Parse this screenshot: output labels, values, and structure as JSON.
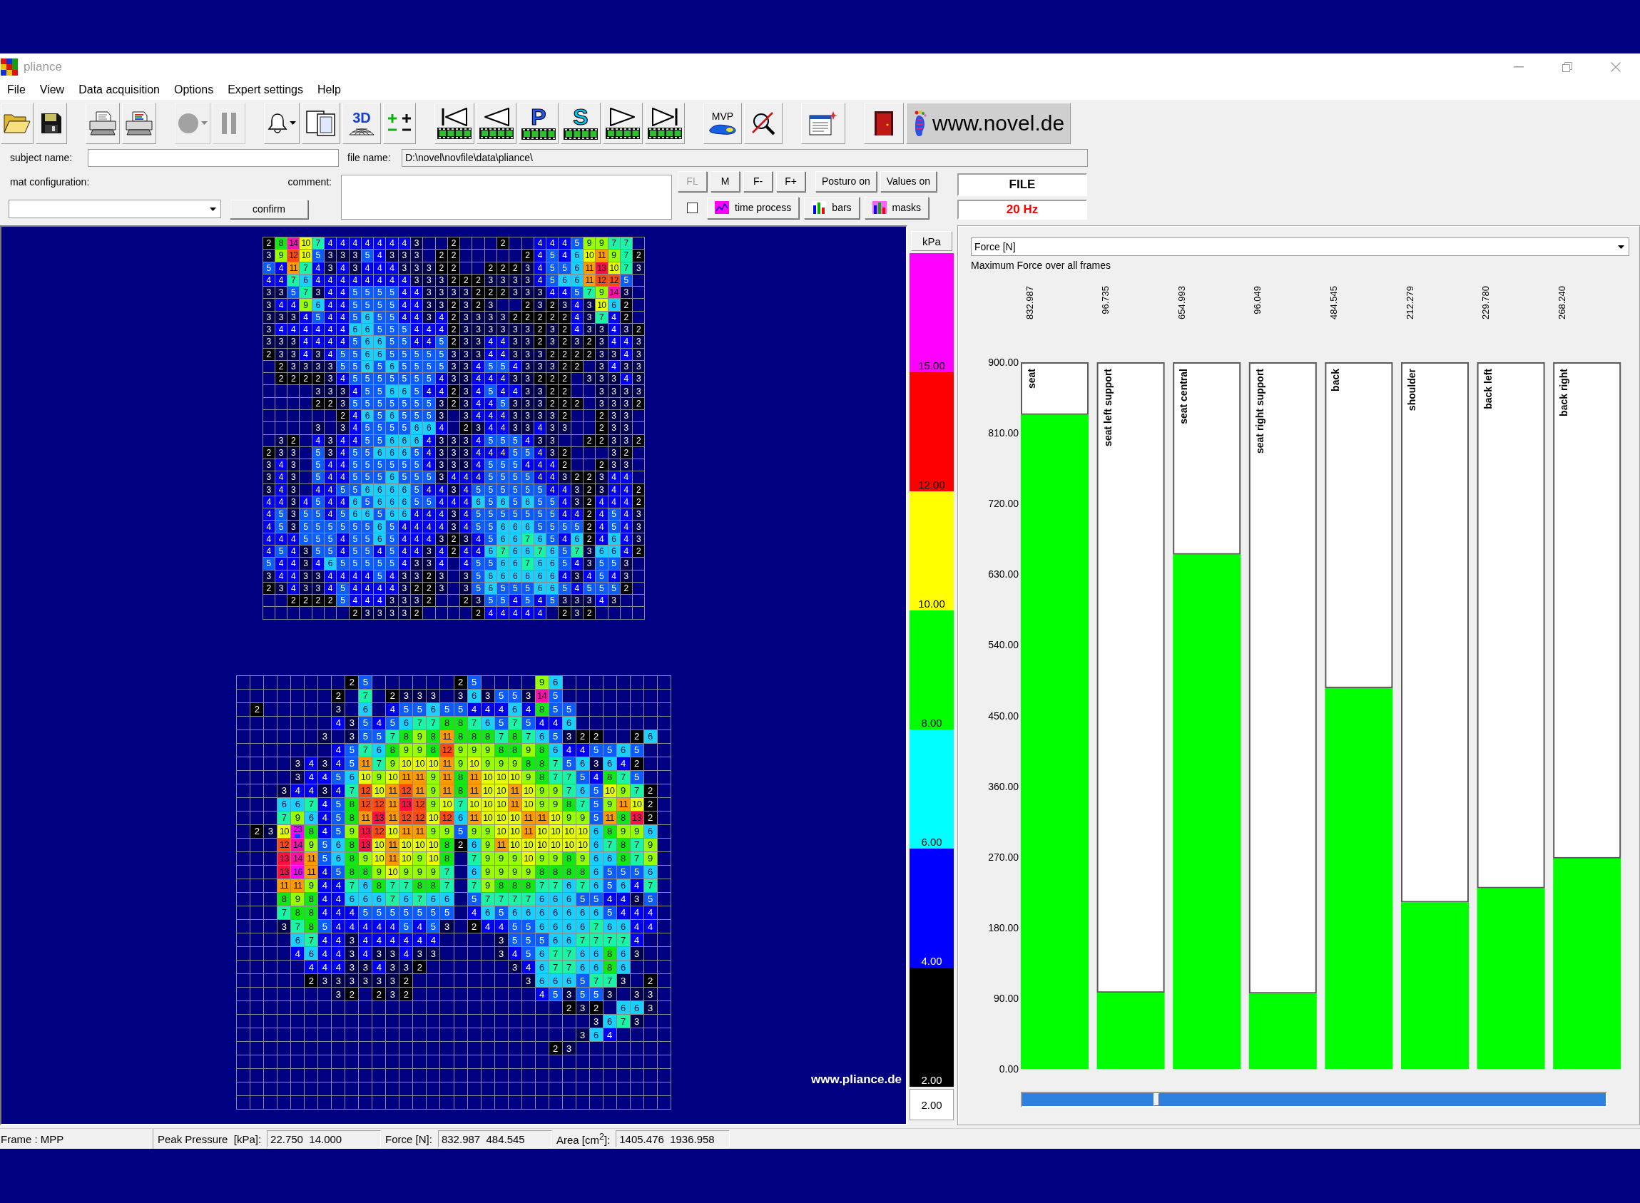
{
  "window": {
    "title": "pliance"
  },
  "menu": [
    "File",
    "View",
    "Data acquisition",
    "Options",
    "Expert settings",
    "Help"
  ],
  "toolbar": [
    [
      {
        "kind": "open",
        "disabled": false,
        "dropdown": false
      },
      {
        "kind": "save",
        "disabled": false,
        "dropdown": false
      }
    ],
    [
      {
        "kind": "print",
        "disabled": false,
        "dropdown": false
      },
      {
        "kind": "colorprint",
        "disabled": false,
        "dropdown": false
      }
    ],
    [
      {
        "kind": "record",
        "disabled": true,
        "dropdown": true
      },
      {
        "kind": "pause",
        "disabled": true,
        "dropdown": false
      }
    ],
    [
      {
        "kind": "bell",
        "disabled": false,
        "dropdown": true
      },
      {
        "kind": "pages",
        "disabled": false,
        "dropdown": false
      },
      {
        "kind": "mesh",
        "label": "3D",
        "disabled": false,
        "dropdown": false
      },
      {
        "kind": "plusminus",
        "disabled": false,
        "dropdown": false
      }
    ],
    [
      {
        "kind": "first",
        "disabled": false,
        "dropdown": false
      },
      {
        "kind": "previous",
        "disabled": false,
        "dropdown": false
      },
      {
        "kind": "letter",
        "label": "P",
        "color": "#1c5cff",
        "disabled": false,
        "dropdown": false
      },
      {
        "kind": "letter",
        "label": "S",
        "color": "#00c8f0",
        "disabled": false,
        "dropdown": false
      },
      {
        "kind": "next",
        "disabled": false,
        "dropdown": false
      },
      {
        "kind": "last",
        "disabled": false,
        "dropdown": false
      }
    ],
    [
      {
        "kind": "mvp",
        "label": "MVP",
        "disabled": false,
        "dropdown": false
      },
      {
        "kind": "nosearch",
        "disabled": false,
        "dropdown": false
      }
    ],
    [
      {
        "kind": "notepad",
        "disabled": false,
        "dropdown": false
      }
    ],
    [
      {
        "kind": "exit",
        "disabled": false,
        "dropdown": false
      },
      {
        "kind": "link",
        "label": "www.novel.de",
        "disabled": false,
        "dropdown": false
      }
    ]
  ],
  "form": {
    "subject_name": {
      "label": "subject name:"
    },
    "file_name": {
      "label": "file name:",
      "value": "D:\\novel\\novfile\\data\\pliance\\"
    },
    "mat_configuration": {
      "label": "mat configuration:"
    },
    "confirm_button": "confirm",
    "comment": {
      "label": "comment:"
    },
    "frame_buttons": [
      {
        "label": "FL",
        "disabled": true
      },
      {
        "label": "M",
        "disabled": false
      },
      {
        "label": "F-",
        "disabled": false
      },
      {
        "label": "F+",
        "disabled": false
      }
    ],
    "toggle_buttons": [
      {
        "label": "Posturo on"
      },
      {
        "label": "Values on"
      }
    ],
    "checkbox": {
      "checked": false
    },
    "display_buttons": [
      {
        "kind": "timeprocess",
        "label": "time process"
      },
      {
        "kind": "bars",
        "label": "bars"
      },
      {
        "kind": "masks",
        "label": "masks"
      }
    ],
    "source": "FILE",
    "rate": "20 Hz"
  },
  "pressure_maps": [
    {
      "rows": [
        [
          "2",
          "8",
          "14",
          "10",
          "7",
          "4",
          "4",
          "4",
          "4",
          "4",
          "4",
          "4",
          "3",
          null,
          null,
          "2",
          null,
          null,
          null,
          "2",
          null,
          null,
          "4",
          "4",
          "4",
          "5",
          "9",
          "9",
          "7",
          "7",
          null
        ],
        [
          "3",
          "9",
          "12",
          "10",
          "5",
          "3",
          "3",
          "3",
          "5",
          "4",
          "3",
          "3",
          "3",
          null,
          "2",
          "2",
          null,
          null,
          null,
          null,
          null,
          "2",
          "4",
          "5",
          "4",
          "6",
          "10",
          "11",
          "9",
          "7",
          "2"
        ],
        [
          "5",
          "4",
          "11",
          "7",
          "4",
          "3",
          "4",
          "3",
          "4",
          "4",
          "4",
          "3",
          "3",
          "3",
          "2",
          "2",
          null,
          null,
          "2",
          "2",
          "2",
          "3",
          "4",
          "5",
          "5",
          "6",
          "11",
          "13",
          "10",
          "7",
          "3"
        ],
        [
          "4",
          "4",
          "7",
          "6",
          "4",
          "4",
          "4",
          "4",
          "4",
          "4",
          "4",
          "4",
          "3",
          "3",
          "3",
          "2",
          "2",
          "2",
          "3",
          "3",
          "3",
          "3",
          "4",
          "5",
          "6",
          "6",
          "11",
          "12",
          "12",
          "5",
          null
        ],
        [
          "3",
          "3",
          "5",
          "7",
          "3",
          "4",
          "4",
          "5",
          "5",
          "5",
          "5",
          "4",
          "4",
          "3",
          "3",
          "3",
          "3",
          "2",
          "2",
          "2",
          "3",
          "3",
          "3",
          "4",
          "4",
          "5",
          "7",
          "9",
          "14",
          "3",
          null
        ],
        [
          "3",
          "4",
          "4",
          "9",
          "6",
          "4",
          "4",
          "5",
          "5",
          "5",
          "5",
          "4",
          "4",
          "3",
          "3",
          "2",
          "3",
          "2",
          "3",
          null,
          null,
          "2",
          "3",
          "2",
          "3",
          "4",
          "3",
          "10",
          "6",
          "2",
          null
        ],
        [
          "3",
          "3",
          "3",
          "4",
          "5",
          "4",
          "4",
          "5",
          "6",
          "5",
          "5",
          "4",
          "4",
          "3",
          "4",
          "2",
          "3",
          "3",
          "3",
          "3",
          "2",
          "2",
          "2",
          "2",
          "2",
          "4",
          "3",
          "7",
          "4",
          "2",
          null
        ],
        [
          "3",
          "4",
          "4",
          "4",
          "4",
          "4",
          "4",
          "6",
          "6",
          "5",
          "5",
          "5",
          "4",
          "4",
          "4",
          "2",
          "3",
          "3",
          "3",
          "3",
          "3",
          "3",
          "2",
          "3",
          "2",
          "4",
          "3",
          "3",
          "4",
          "3",
          "2"
        ],
        [
          "3",
          "3",
          "3",
          "4",
          "4",
          "4",
          "4",
          "5",
          "6",
          "6",
          "5",
          "5",
          "4",
          "4",
          "5",
          "2",
          "3",
          "3",
          "4",
          "4",
          "3",
          "3",
          "2",
          "3",
          "2",
          "3",
          "2",
          "3",
          "4",
          "4",
          "3"
        ],
        [
          "2",
          "3",
          "3",
          "4",
          "3",
          "4",
          "5",
          "5",
          "6",
          "6",
          "5",
          "5",
          "5",
          "5",
          "5",
          "3",
          "3",
          "3",
          "4",
          "4",
          "3",
          "3",
          "3",
          "2",
          "2",
          "2",
          "2",
          "3",
          "3",
          "4",
          "3"
        ],
        [
          null,
          "2",
          "3",
          "3",
          "3",
          "3",
          "5",
          "5",
          "6",
          "5",
          "6",
          "5",
          "5",
          "5",
          "5",
          "3",
          "3",
          "4",
          "5",
          "5",
          "4",
          "3",
          "3",
          "3",
          "2",
          "2",
          null,
          "3",
          "4",
          "3",
          "3"
        ],
        [
          null,
          "2",
          "2",
          "2",
          "2",
          "3",
          "4",
          "5",
          "5",
          "5",
          "5",
          "5",
          "5",
          "5",
          "4",
          "3",
          "3",
          "4",
          "4",
          "4",
          "3",
          "3",
          "2",
          "2",
          "2",
          null,
          "3",
          "3",
          "3",
          "4",
          "3"
        ],
        [
          null,
          null,
          null,
          null,
          "3",
          "3",
          "3",
          "4",
          "5",
          "5",
          "6",
          "6",
          "5",
          "4",
          "4",
          "2",
          "3",
          "4",
          "5",
          "4",
          "4",
          "3",
          "3",
          "2",
          "2",
          null,
          null,
          "3",
          "3",
          "3",
          "3"
        ],
        [
          null,
          null,
          null,
          null,
          "2",
          "2",
          "3",
          "5",
          "5",
          "5",
          "5",
          "5",
          "5",
          "5",
          "3",
          "2",
          "3",
          "4",
          "4",
          "5",
          "3",
          "3",
          "3",
          "2",
          "2",
          "2",
          null,
          "3",
          "3",
          "3",
          "2"
        ],
        [
          null,
          null,
          null,
          null,
          null,
          null,
          "2",
          "4",
          "6",
          "5",
          "6",
          "5",
          "5",
          "5",
          "3",
          null,
          "3",
          "4",
          "4",
          "4",
          "3",
          "3",
          "3",
          "3",
          "2",
          null,
          null,
          "2",
          "3",
          "3",
          null
        ],
        [
          null,
          null,
          null,
          null,
          "3",
          null,
          "3",
          "4",
          "5",
          "5",
          "5",
          "5",
          "6",
          "6",
          "4",
          null,
          "2",
          "3",
          "4",
          "4",
          "3",
          "3",
          "4",
          "3",
          "3",
          null,
          null,
          "2",
          "3",
          "3",
          null
        ],
        [
          null,
          "3",
          "2",
          null,
          "4",
          "3",
          "4",
          "4",
          "5",
          "5",
          "6",
          "6",
          "6",
          "4",
          "3",
          "3",
          "3",
          "4",
          "5",
          "5",
          "5",
          "4",
          "3",
          "3",
          null,
          null,
          "2",
          "2",
          "3",
          "3",
          "2"
        ],
        [
          "2",
          "3",
          "3",
          null,
          "5",
          "3",
          "4",
          "5",
          "5",
          "6",
          "6",
          "6",
          "5",
          "4",
          "3",
          "3",
          "3",
          "4",
          "4",
          "4",
          "5",
          "5",
          "4",
          "3",
          "2",
          null,
          null,
          null,
          "3",
          "2",
          null
        ],
        [
          "3",
          "4",
          "3",
          null,
          "5",
          "4",
          "4",
          "5",
          "5",
          "5",
          "5",
          "5",
          "5",
          "4",
          "3",
          "3",
          "3",
          "4",
          "5",
          "5",
          "5",
          "4",
          "4",
          "4",
          "2",
          null,
          null,
          "2",
          "3",
          "3",
          null
        ],
        [
          "3",
          "4",
          "3",
          null,
          "5",
          "4",
          "4",
          "5",
          "5",
          "5",
          "6",
          "5",
          "5",
          "5",
          "3",
          "4",
          "4",
          "4",
          "5",
          "5",
          "5",
          "5",
          "4",
          "4",
          "3",
          "2",
          "2",
          "3",
          "4",
          "4",
          null
        ],
        [
          "3",
          "4",
          "3",
          null,
          "4",
          "4",
          "5",
          "5",
          "6",
          "6",
          "6",
          "6",
          "5",
          "4",
          "4",
          "3",
          "4",
          "5",
          "5",
          "5",
          "5",
          "5",
          "5",
          "4",
          "4",
          "3",
          "2",
          "3",
          "4",
          "4",
          "2"
        ],
        [
          "4",
          "4",
          "3",
          "4",
          "5",
          "4",
          "4",
          "6",
          "5",
          "6",
          "6",
          "6",
          "5",
          "5",
          "4",
          "4",
          "4",
          "6",
          "5",
          "6",
          "5",
          "6",
          "5",
          "5",
          "4",
          "3",
          "2",
          "4",
          "4",
          "4",
          "2"
        ],
        [
          "4",
          "5",
          "3",
          "5",
          "5",
          "4",
          "5",
          "6",
          "6",
          "5",
          "6",
          "6",
          "4",
          "4",
          "4",
          "3",
          "4",
          "5",
          "5",
          "5",
          "5",
          "5",
          "5",
          "5",
          "4",
          "4",
          "2",
          "4",
          "5",
          "4",
          "3"
        ],
        [
          "4",
          "5",
          "3",
          "5",
          "5",
          "5",
          "5",
          "5",
          "5",
          "6",
          "5",
          "4",
          "4",
          "4",
          "4",
          "3",
          "4",
          "5",
          "5",
          "6",
          "6",
          "6",
          "5",
          "5",
          "5",
          "5",
          "2",
          "4",
          "5",
          "4",
          "3"
        ],
        [
          "4",
          "4",
          "4",
          "5",
          "5",
          "5",
          "4",
          "5",
          "5",
          "6",
          "5",
          "4",
          "4",
          "4",
          "3",
          "2",
          "3",
          "4",
          "5",
          "6",
          "6",
          "7",
          "6",
          "5",
          "4",
          "6",
          "2",
          "4",
          "6",
          "4",
          "3"
        ],
        [
          "4",
          "5",
          "4",
          "3",
          "5",
          "5",
          "4",
          "5",
          "5",
          "4",
          "5",
          "4",
          "4",
          "3",
          "4",
          "2",
          "4",
          "4",
          "6",
          "7",
          "6",
          "6",
          "7",
          "6",
          "5",
          "7",
          "3",
          "6",
          "6",
          "4",
          "2"
        ],
        [
          "5",
          "4",
          "4",
          "3",
          "4",
          "6",
          "5",
          "5",
          "5",
          "5",
          "5",
          "4",
          "3",
          "3",
          "4",
          null,
          "4",
          "5",
          "5",
          "6",
          "6",
          "7",
          "6",
          "6",
          "5",
          "4",
          "3",
          "5",
          "5",
          "3",
          null
        ],
        [
          "3",
          "4",
          "4",
          "3",
          "3",
          "4",
          "4",
          "4",
          "4",
          "5",
          "4",
          "3",
          "3",
          "2",
          "3",
          null,
          "3",
          "5",
          "6",
          "6",
          "6",
          "6",
          "6",
          "6",
          "4",
          "3",
          "4",
          "5",
          "4",
          "3",
          null
        ],
        [
          "2",
          "3",
          "4",
          "3",
          "3",
          "4",
          "5",
          "4",
          "4",
          "4",
          "4",
          "3",
          "2",
          "2",
          "3",
          null,
          "3",
          "5",
          "6",
          "5",
          "5",
          "5",
          "6",
          "6",
          "5",
          "4",
          "5",
          "5",
          "5",
          "2",
          null
        ],
        [
          null,
          null,
          "2",
          "2",
          "2",
          "2",
          "5",
          "4",
          "4",
          "4",
          "3",
          "3",
          "3",
          "2",
          null,
          null,
          "2",
          "3",
          "5",
          "5",
          "4",
          "5",
          "4",
          "5",
          "3",
          "3",
          "3",
          "4",
          "3",
          null,
          null
        ],
        [
          null,
          null,
          null,
          null,
          null,
          null,
          null,
          "2",
          "3",
          "3",
          "3",
          "3",
          "2",
          null,
          null,
          null,
          null,
          "2",
          "4",
          "4",
          "4",
          "4",
          "4",
          null,
          "2",
          "3",
          "2",
          null,
          null,
          null,
          null
        ]
      ]
    },
    {
      "rows": [
        [
          null,
          null,
          null,
          null,
          null,
          null,
          null,
          null,
          "2",
          "5",
          null,
          null,
          null,
          null,
          null,
          null,
          "2",
          "5",
          null,
          null,
          null,
          null,
          "9",
          "6",
          null,
          null,
          null,
          null,
          null,
          null,
          null,
          null
        ],
        [
          null,
          null,
          null,
          null,
          null,
          null,
          null,
          "2",
          null,
          "7",
          null,
          "2",
          "3",
          "3",
          "3",
          null,
          "3",
          "6",
          "3",
          "5",
          "5",
          "3",
          "14",
          "5",
          null,
          null,
          null,
          null,
          null,
          null,
          null,
          null
        ],
        [
          null,
          "2",
          null,
          null,
          null,
          null,
          null,
          "3",
          null,
          "6",
          null,
          "4",
          "5",
          "5",
          "6",
          "5",
          "5",
          "4",
          "4",
          "4",
          "6",
          "4",
          "8",
          "5",
          "5",
          null,
          null,
          null,
          null,
          null,
          null,
          null
        ],
        [
          null,
          null,
          null,
          null,
          null,
          null,
          null,
          "4",
          "3",
          "5",
          "4",
          "5",
          "6",
          "7",
          "7",
          "8",
          "8",
          "7",
          "6",
          "5",
          "7",
          "5",
          "4",
          "4",
          "6",
          null,
          null,
          null,
          null,
          null,
          null,
          null
        ],
        [
          null,
          null,
          null,
          null,
          null,
          null,
          "3",
          null,
          "3",
          "5",
          "5",
          "7",
          "8",
          "9",
          "8",
          "11",
          "8",
          "8",
          "8",
          "7",
          "8",
          "7",
          "6",
          "5",
          "3",
          "2",
          "2",
          null,
          null,
          "2",
          "6",
          null
        ],
        [
          null,
          null,
          null,
          null,
          null,
          null,
          null,
          "4",
          "5",
          "7",
          "6",
          "8",
          "9",
          "9",
          "8",
          "12",
          "9",
          "9",
          "9",
          "8",
          "8",
          "9",
          "8",
          "6",
          "4",
          "4",
          "5",
          "5",
          "6",
          "5",
          null,
          null
        ],
        [
          null,
          null,
          null,
          null,
          "3",
          "4",
          "3",
          "4",
          "5",
          "11",
          "7",
          "9",
          "10",
          "10",
          "10",
          "11",
          "9",
          "10",
          "9",
          "9",
          "9",
          "8",
          "8",
          "7",
          "5",
          "6",
          "3",
          "6",
          "4",
          "2",
          null,
          null
        ],
        [
          null,
          null,
          null,
          null,
          "3",
          "4",
          "4",
          "5",
          "6",
          "10",
          "9",
          "10",
          "11",
          "11",
          "9",
          "11",
          "8",
          "11",
          "10",
          "10",
          "10",
          "9",
          "8",
          "7",
          "7",
          "5",
          "4",
          "8",
          "7",
          "5",
          null,
          null
        ],
        [
          null,
          null,
          null,
          "3",
          "4",
          "4",
          "3",
          "4",
          "7",
          "12",
          "10",
          "11",
          "12",
          "11",
          "9",
          "11",
          "8",
          "11",
          "10",
          "10",
          "11",
          "10",
          "9",
          "9",
          "7",
          "6",
          "5",
          "10",
          "9",
          "7",
          "2",
          null
        ],
        [
          null,
          null,
          null,
          "6",
          "6",
          "7",
          "4",
          "5",
          "8",
          "12",
          "12",
          "11",
          "13",
          "12",
          "9",
          "10",
          "7",
          "10",
          "10",
          "10",
          "11",
          "10",
          "9",
          "9",
          "8",
          "7",
          "5",
          "9",
          "11",
          "10",
          "2",
          null
        ],
        [
          null,
          null,
          null,
          "7",
          "9",
          "6",
          "4",
          "5",
          "8",
          "11",
          "13",
          "11",
          "12",
          "12",
          "10",
          "12",
          "6",
          "11",
          "10",
          "10",
          "10",
          "11",
          "11",
          "10",
          "9",
          "9",
          "5",
          "11",
          "8",
          "13",
          "2",
          null
        ],
        [
          null,
          "2",
          "3",
          "10",
          {
            "kind": "peak",
            "value": "23"
          },
          "8",
          "4",
          "5",
          "9",
          "13",
          "12",
          "10",
          "11",
          "11",
          "9",
          "9",
          "5",
          "9",
          "9",
          "10",
          "10",
          "11",
          "10",
          "10",
          "10",
          "10",
          "6",
          "8",
          "9",
          "9",
          "6",
          null
        ],
        [
          null,
          null,
          null,
          "12",
          "14",
          "9",
          "5",
          "6",
          "8",
          "13",
          "10",
          "11",
          "10",
          "10",
          "10",
          "8",
          "2",
          "6",
          "9",
          "11",
          "10",
          "10",
          "10",
          "10",
          "10",
          "10",
          "6",
          "7",
          "8",
          "7",
          "9",
          null
        ],
        [
          null,
          null,
          null,
          "13",
          "14",
          "11",
          "5",
          "6",
          "8",
          "9",
          "10",
          "11",
          "10",
          "9",
          "10",
          "8",
          null,
          "7",
          "9",
          "9",
          "9",
          "10",
          "9",
          "9",
          "8",
          "9",
          "6",
          "6",
          "8",
          "7",
          "9",
          null
        ],
        [
          null,
          null,
          null,
          "13",
          "16",
          "11",
          "4",
          "5",
          "8",
          "8",
          "9",
          "10",
          "9",
          "9",
          "9",
          "7",
          null,
          "6",
          "9",
          "9",
          "9",
          "9",
          "8",
          "8",
          "8",
          "8",
          "6",
          "5",
          "5",
          "5",
          "6",
          null
        ],
        [
          null,
          null,
          null,
          "11",
          "11",
          "9",
          "4",
          "4",
          "7",
          "6",
          "8",
          "7",
          "7",
          "8",
          "8",
          "7",
          null,
          "7",
          "9",
          "8",
          "8",
          "8",
          "7",
          "7",
          "6",
          "7",
          "6",
          "5",
          "6",
          "4",
          "7",
          null
        ],
        [
          null,
          null,
          null,
          "8",
          "9",
          "8",
          "4",
          "4",
          "6",
          "6",
          "6",
          "7",
          "6",
          "7",
          "6",
          "6",
          null,
          "5",
          "7",
          "7",
          "7",
          "7",
          "6",
          "6",
          "6",
          "5",
          "5",
          "4",
          "4",
          "3",
          "5",
          null
        ],
        [
          null,
          null,
          null,
          "7",
          "8",
          "8",
          "4",
          "4",
          "4",
          "5",
          "5",
          "5",
          "5",
          "5",
          "5",
          "5",
          null,
          "4",
          "6",
          "5",
          "6",
          "6",
          "6",
          "6",
          "6",
          "6",
          "6",
          "5",
          "4",
          "4",
          "4",
          null
        ],
        [
          null,
          null,
          null,
          "3",
          "7",
          "8",
          "5",
          "4",
          "4",
          "4",
          "4",
          "4",
          "5",
          "4",
          "5",
          "3",
          null,
          "2",
          "4",
          "4",
          "5",
          "5",
          "6",
          "6",
          "6",
          "6",
          "7",
          "6",
          "6",
          "4",
          "4",
          null
        ],
        [
          null,
          null,
          null,
          null,
          "6",
          "7",
          "4",
          "4",
          "3",
          "4",
          "4",
          "4",
          "4",
          "4",
          "4",
          null,
          null,
          null,
          null,
          "3",
          "5",
          "5",
          "5",
          "6",
          "6",
          "7",
          "7",
          "7",
          "7",
          "4",
          null,
          null
        ],
        [
          null,
          null,
          null,
          null,
          "4",
          "6",
          "4",
          "4",
          "3",
          "4",
          "3",
          "3",
          "4",
          "3",
          "3",
          null,
          null,
          null,
          null,
          "3",
          "4",
          "5",
          "6",
          "7",
          "7",
          "6",
          "6",
          "8",
          "6",
          "3",
          null,
          null
        ],
        [
          null,
          null,
          null,
          null,
          null,
          "4",
          "4",
          "4",
          "3",
          "3",
          "4",
          "3",
          "3",
          "2",
          null,
          null,
          null,
          null,
          null,
          null,
          "3",
          "4",
          "6",
          "7",
          "7",
          "6",
          "6",
          "8",
          "6",
          null,
          null,
          null
        ],
        [
          null,
          null,
          null,
          null,
          null,
          "2",
          "3",
          "3",
          "3",
          "3",
          "3",
          "3",
          "2",
          null,
          null,
          null,
          null,
          null,
          null,
          null,
          null,
          "3",
          "6",
          "6",
          "6",
          "5",
          "7",
          "7",
          "3",
          null,
          "2",
          null
        ],
        [
          null,
          null,
          null,
          null,
          null,
          null,
          null,
          "3",
          "2",
          null,
          "2",
          "3",
          "2",
          null,
          null,
          null,
          null,
          null,
          null,
          null,
          null,
          null,
          "4",
          "5",
          "3",
          "5",
          "5",
          "3",
          null,
          "3",
          "3",
          null
        ],
        [
          null,
          null,
          null,
          null,
          null,
          null,
          null,
          null,
          null,
          null,
          null,
          null,
          null,
          null,
          null,
          null,
          null,
          null,
          null,
          null,
          null,
          null,
          null,
          null,
          "2",
          "3",
          "2",
          null,
          "6",
          "6",
          "3",
          null
        ],
        [
          null,
          null,
          null,
          null,
          null,
          null,
          null,
          null,
          null,
          null,
          null,
          null,
          null,
          null,
          null,
          null,
          null,
          null,
          null,
          null,
          null,
          null,
          null,
          null,
          null,
          null,
          "3",
          "6",
          "7",
          "3",
          null,
          null
        ],
        [
          null,
          null,
          null,
          null,
          null,
          null,
          null,
          null,
          null,
          null,
          null,
          null,
          null,
          null,
          null,
          null,
          null,
          null,
          null,
          null,
          null,
          null,
          null,
          null,
          null,
          "3",
          "6",
          "4",
          null,
          null,
          null,
          null
        ],
        [
          null,
          null,
          null,
          null,
          null,
          null,
          null,
          null,
          null,
          null,
          null,
          null,
          null,
          null,
          null,
          null,
          null,
          null,
          null,
          null,
          null,
          null,
          null,
          "2",
          "3",
          null,
          null,
          null,
          null,
          null,
          null,
          null
        ],
        [
          null,
          null,
          null,
          null,
          null,
          null,
          null,
          null,
          null,
          null,
          null,
          null,
          null,
          null,
          null,
          null,
          null,
          null,
          null,
          null,
          null,
          null,
          null,
          null,
          null,
          null,
          null,
          null,
          null,
          null,
          null,
          null
        ],
        [
          null,
          null,
          null,
          null,
          null,
          null,
          null,
          null,
          null,
          null,
          null,
          null,
          null,
          null,
          null,
          null,
          null,
          null,
          null,
          null,
          null,
          null,
          null,
          null,
          null,
          null,
          null,
          null,
          null,
          null,
          null,
          null
        ],
        [
          null,
          null,
          null,
          null,
          null,
          null,
          null,
          null,
          null,
          null,
          null,
          null,
          null,
          null,
          null,
          null,
          null,
          null,
          null,
          null,
          null,
          null,
          null,
          null,
          null,
          null,
          null,
          null,
          null,
          null,
          null,
          null
        ],
        [
          null,
          null,
          null,
          null,
          null,
          null,
          null,
          null,
          null,
          null,
          null,
          null,
          null,
          null,
          null,
          null,
          null,
          null,
          null,
          null,
          null,
          null,
          null,
          null,
          null,
          null,
          null,
          null,
          null,
          null,
          null,
          null
        ]
      ]
    }
  ],
  "canvas_caption": "www.pliance.de",
  "color_scale": {
    "unit": "kPa",
    "bands": [
      {
        "label": "15.00",
        "color": "#ff00ff"
      },
      {
        "label": "12.00",
        "color": "#ff0000"
      },
      {
        "label": "10.00",
        "color": "#ffff00"
      },
      {
        "label": "8.00",
        "color": "#00ff00"
      },
      {
        "label": "6.00",
        "color": "#00ffff"
      },
      {
        "label": "4.00",
        "color": "#0000ff"
      },
      {
        "label": "2.00",
        "color": "#000000"
      }
    ],
    "floor": "2.00"
  },
  "chart": {
    "selector": "Force [N]",
    "subtitle": "Maximum Force over all frames",
    "chart_data": {
      "type": "bar",
      "categories": [
        "seat",
        "seat left support",
        "seat central",
        "seat right support",
        "back",
        "shoulder",
        "back left",
        "back right"
      ],
      "series": [
        {
          "color": "#00ff00",
          "values": [
            833,
            97,
            655,
            96,
            485,
            212,
            230,
            268
          ]
        }
      ],
      "ylim": [
        0,
        900
      ],
      "yticks": [
        {
          "value": 0,
          "label": "0.00"
        },
        {
          "value": 90,
          "label": "90.00"
        },
        {
          "value": 180,
          "label": "180.00"
        },
        {
          "value": 270,
          "label": "270.00"
        },
        {
          "value": 360,
          "label": "360.00"
        },
        {
          "value": 450,
          "label": "450.00"
        },
        {
          "value": 540,
          "label": "540.00"
        },
        {
          "value": 630,
          "label": "630.00"
        },
        {
          "value": 720,
          "label": "720.00"
        },
        {
          "value": 810,
          "label": "810.00"
        },
        {
          "value": 900,
          "label": "900.00"
        }
      ],
      "value_labels": [
        "832.987",
        "96.735",
        "654.993",
        "96.049",
        "484.545",
        "212.279",
        "229.780",
        "268.240"
      ]
    },
    "frame_slider": {
      "level": 0.23
    }
  },
  "status_bar": {
    "frame": "Frame : MPP",
    "fields": [
      {
        "label": "Peak Pressure  [kPa]:",
        "value": "22.750  14.000"
      },
      {
        "label": "Force [N]:",
        "value": "832.987  484.545"
      },
      {
        "label": "Area [cm$^{2}$]:",
        "value": "1405.476  1936.958"
      }
    ]
  }
}
